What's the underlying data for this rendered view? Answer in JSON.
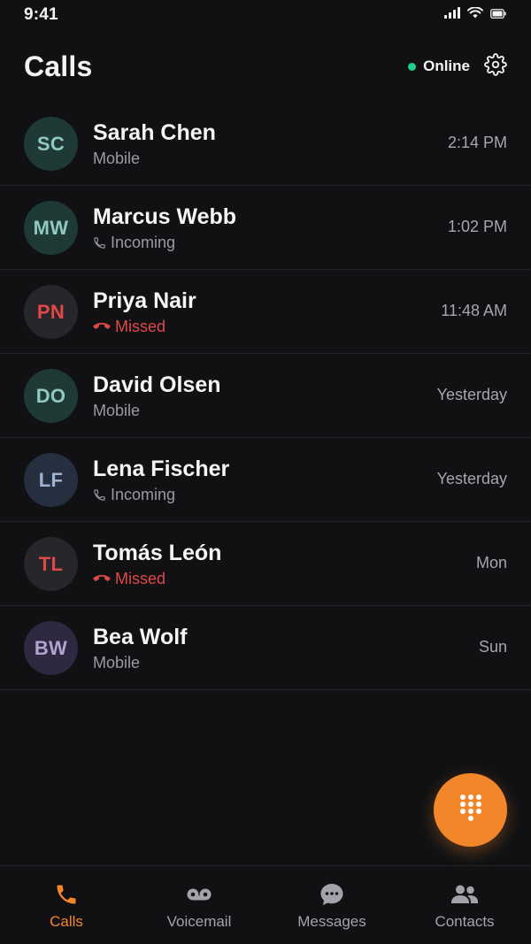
{
  "status_bar": {
    "time": "9:41"
  },
  "header": {
    "title": "Calls",
    "presence_label": "Online",
    "presence_color": "#1fce8a"
  },
  "calls": [
    {
      "initials": "SC",
      "name": "Sarah Chen",
      "type": "Mobile",
      "icon": "",
      "time": "2:14 PM",
      "missed": false,
      "avatar_bg": "#1f3a36",
      "avatar_fg": "#8fc9bf"
    },
    {
      "initials": "MW",
      "name": "Marcus Webb",
      "type": "Incoming",
      "icon": "phone-incoming-icon",
      "time": "1:02 PM",
      "missed": false,
      "avatar_bg": "#1f3a36",
      "avatar_fg": "#8fc9bf"
    },
    {
      "initials": "PN",
      "name": "Priya Nair",
      "type": "Missed",
      "icon": "phone-missed-icon",
      "time": "11:48 AM",
      "missed": true,
      "avatar_bg": "#27262a",
      "avatar_fg": "#e04848"
    },
    {
      "initials": "DO",
      "name": "David Olsen",
      "type": "Mobile",
      "icon": "",
      "time": "Yesterday",
      "missed": false,
      "avatar_bg": "#1f3a36",
      "avatar_fg": "#8fc9bf"
    },
    {
      "initials": "LF",
      "name": "Lena Fischer",
      "type": "Incoming",
      "icon": "phone-incoming-icon",
      "time": "Yesterday",
      "missed": false,
      "avatar_bg": "#262f40",
      "avatar_fg": "#9fb2d2"
    },
    {
      "initials": "TL",
      "name": "Tomás León",
      "type": "Missed",
      "icon": "phone-missed-icon",
      "time": "Mon",
      "missed": true,
      "avatar_bg": "#27262a",
      "avatar_fg": "#e04848"
    },
    {
      "initials": "BW",
      "name": "Bea Wolf",
      "type": "Mobile",
      "icon": "",
      "time": "Sun",
      "missed": false,
      "avatar_bg": "#2e2840",
      "avatar_fg": "#b1a4d0"
    }
  ],
  "fab": {
    "icon": "dialpad-icon",
    "color": "#f2862a"
  },
  "tabs": [
    {
      "label": "Calls",
      "icon": "phone-icon",
      "active": true
    },
    {
      "label": "Voicemail",
      "icon": "voicemail-icon",
      "active": false
    },
    {
      "label": "Messages",
      "icon": "message-bubble-icon",
      "active": false
    },
    {
      "label": "Contacts",
      "icon": "contacts-icon",
      "active": false
    }
  ],
  "colors": {
    "accent": "#f2862a",
    "missed": "#e04848",
    "background": "#111113"
  }
}
